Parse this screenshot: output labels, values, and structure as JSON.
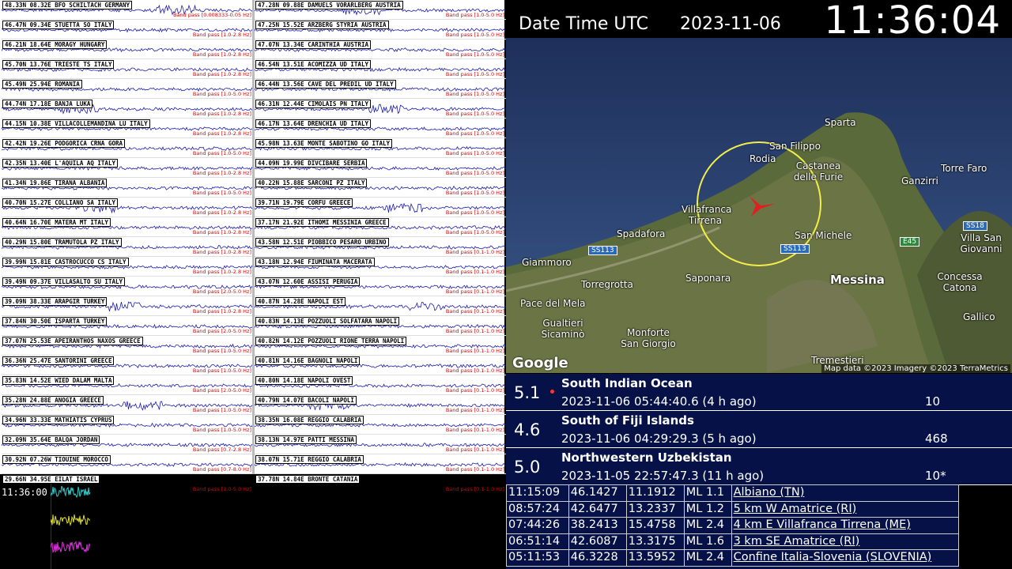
{
  "clock": {
    "label": "Date Time UTC",
    "date": "2023-11-06",
    "time": "11:36:04"
  },
  "stations_left": [
    {
      "name": "48.33N 08.32E BFO SCHILTACH GERMANY",
      "band": "Band pass [0.008333-0.05 Hz]"
    },
    {
      "name": "46.47N 09.34E STUETTA SO ITALY",
      "band": "Band pass [1.0-2.8 Hz]"
    },
    {
      "name": "46.21N 18.64E MORAGY HUNGARY",
      "band": "Band pass [1.0-2.8 Hz]"
    },
    {
      "name": "45.70N 13.76E TRIESTE TS ITALY",
      "band": "Band pass [1.0-2.8 Hz]"
    },
    {
      "name": "45.49N 25.94E ROMANIA",
      "band": "Band pass [1.0-5.0 Hz]"
    },
    {
      "name": "44.74N 17.18E BANJA LUKA",
      "band": "Band pass [1.0-2.8 Hz]"
    },
    {
      "name": "44.15N 10.38E VILLACOLLEMANDINA LU ITALY",
      "band": "Band pass [1.0-2.8 Hz]"
    },
    {
      "name": "42.42N 19.26E PODGORICA CRNA GORA",
      "band": "Band pass [1.0-5.0 Hz]"
    },
    {
      "name": "42.35N 13.40E L'AQUILA AQ ITALY",
      "band": "Band pass [1.0-2.8 Hz]"
    },
    {
      "name": "41.34N 19.86E TIRANA ALBANIA",
      "band": "Band pass [1.0-5.0 Hz]"
    },
    {
      "name": "40.70N 15.27E COLLIANO SA ITALY",
      "band": "Band pass [1.0-2.8 Hz]"
    },
    {
      "name": "40.64N 16.70E MATERA MT ITALY",
      "band": "Band pass [1.0-2.8 Hz]"
    },
    {
      "name": "40.29N 15.80E TRAMUTOLA PZ ITALY",
      "band": "Band pass [1.0-2.8 Hz]"
    },
    {
      "name": "39.99N 15.81E CASTROCUCCO CS ITALY",
      "band": "Band pass [1.0-2.8 Hz]"
    },
    {
      "name": "39.49N 09.37E VILLASALTO SU ITALY",
      "band": "Band pass [2.0-5.0 Hz]"
    },
    {
      "name": "39.09N 38.33E ARAPGIR TURKEY",
      "band": "Band pass [1.0-2.8 Hz]"
    },
    {
      "name": "37.84N 30.50E ISPARTA TURKEY",
      "band": "Band pass [2.0-5.0 Hz]"
    },
    {
      "name": "37.07N 25.53E APEIRANTHOS NAXOS GREECE",
      "band": "Band pass [1.0-5.0 Hz]"
    },
    {
      "name": "36.36N 25.47E SANTORINI GREECE",
      "band": "Band pass [1.0-5.0 Hz]"
    },
    {
      "name": "35.83N 14.52E WIED DALAM MALTA",
      "band": "Band pass [2.0-5.0 Hz]"
    },
    {
      "name": "35.28N 24.88E ANOGIA GREECE",
      "band": "Band pass [1.0-5.0 Hz]"
    },
    {
      "name": "34.96N 33.33E MATHIATIS CYPRUS",
      "band": "Band pass [1.0-5.0 Hz]"
    },
    {
      "name": "32.09N 35.64E BALQA JORDAN",
      "band": "Band pass [0.7-2.8 Hz]"
    },
    {
      "name": "30.92N 07.26W TIOUINE MOROCCO",
      "band": "Band pass [0.7-8.0 Hz]"
    },
    {
      "name": "29.66N 34.95E EILAT ISRAEL",
      "band": "Band pass [1.0-5.0 Hz]"
    }
  ],
  "stations_right": [
    {
      "name": "47.28N 09.88E DAMUELS VORARLBERG AUSTRIA",
      "band": "Band pass [1.0-5.0 Hz]"
    },
    {
      "name": "47.25N 15.52E ARZBERG STYRIA AUSTRIA",
      "band": "Band pass [1.0-5.0 Hz]"
    },
    {
      "name": "47.07N 13.34E CARINTHIA AUSTRIA",
      "band": "Band pass [1.0-5.0 Hz]"
    },
    {
      "name": "46.54N 13.51E ACOMIZZA UD ITALY",
      "band": "Band pass [1.0-5.0 Hz]"
    },
    {
      "name": "46.44N 13.56E CAVE DEL PREDIL UD ITALY",
      "band": "Band pass [1.0-5.0 Hz]"
    },
    {
      "name": "46.31N 12.44E CIMOLAIS PN ITALY",
      "band": "Band pass [1.0-5.0 Hz]"
    },
    {
      "name": "46.17N 13.64E DRENCHIA UD ITALY",
      "band": "Band pass [1.0-5.0 Hz]"
    },
    {
      "name": "45.98N 13.63E MONTE SABOTINO GO ITALY",
      "band": "Band pass [1.0-5.0 Hz]"
    },
    {
      "name": "44.09N 19.99E DIVCIBARE SERBIA",
      "band": "Band pass [1.0-5.0 Hz]"
    },
    {
      "name": "40.22N 15.88E SARCONI PZ ITALY",
      "band": "Band pass [1.0-5.0 Hz]"
    },
    {
      "name": "39.71N 19.79E CORFU GREECE",
      "band": "Band pass [1.0-5.0 Hz]"
    },
    {
      "name": "37.17N 21.92E ITHOMI MESSINIA GREECE",
      "band": "Band pass [1.0-5.0 Hz]"
    },
    {
      "name": "43.58N 12.51E PIOBBICO PESARO URBINO",
      "band": "Band pass [0.1-1.0 Hz]"
    },
    {
      "name": "43.18N 12.94E FIUMINATA MACERATA",
      "band": "Band pass [0.1-1.0 Hz]"
    },
    {
      "name": "43.07N 12.60E ASSISI PERUGIA",
      "band": "Band pass [0.1-1.0 Hz]"
    },
    {
      "name": "40.87N 14.28E NAPOLI EST",
      "band": "Band pass [0.1-1.0 Hz]"
    },
    {
      "name": "40.83N 14.13E POZZUOLI SOLFATARA NAPOLI",
      "band": "Band pass [0.1-1.0 Hz]"
    },
    {
      "name": "40.82N 14.12E POZZUOLI RIONE TERRA NAPOLI",
      "band": "Band pass [0.1-1.0 Hz]"
    },
    {
      "name": "40.81N 14.16E BAGNOLI NAPOLI",
      "band": "Band pass [0.1-1.0 Hz]"
    },
    {
      "name": "40.80N 14.18E NAPOLI OVEST",
      "band": "Band pass [0.1-1.0 Hz]"
    },
    {
      "name": "40.79N 14.07E BACOLI NAPOLI",
      "band": "Band pass [0.1-1.0 Hz]"
    },
    {
      "name": "38.35N 16.08E REGGIO CALABRIA",
      "band": "Band pass [0.1-1.0 Hz]"
    },
    {
      "name": "38.13N 14.97E PATTI MESSINA",
      "band": "Band pass [0.1-1.0 Hz]"
    },
    {
      "name": "38.07N 15.71E REGGIO CALABRIA",
      "band": "Band pass [0.1-1.0 Hz]"
    },
    {
      "name": "37.78N 14.84E BRONTE CATANIA",
      "band": "Band pass [0.1-1.0 Hz]"
    }
  ],
  "strip": {
    "time": "11:36:00"
  },
  "map": {
    "places": [
      "Sparta",
      "San Filippo",
      "Rodia",
      "Castanea delle Furie",
      "Torre Faro",
      "Ganzirri",
      "Villafranca Tirrena",
      "Spadafora",
      "San Michele",
      "Messina",
      "Giammoro",
      "Torregrotta",
      "Saponara",
      "Pace del Mela",
      "Gualtieri Sicaminò",
      "Monforte San Giorgio",
      "Villa San Giovanni",
      "Concessa Catona",
      "Gallico",
      "Tremestieri"
    ],
    "roads": [
      "SS113",
      "SS113",
      "E45",
      "SS18"
    ],
    "brand": "Google",
    "attribution": "Map data ©2023 Imagery ©2023 TerraMetrics"
  },
  "quakes": [
    {
      "mag": "5.1",
      "region": "South Indian Ocean",
      "datetime": "2023-11-06 05:44:40.6 (4 h ago)",
      "num": "10",
      "new": true
    },
    {
      "mag": "4.6",
      "region": "South of Fiji Islands",
      "datetime": "2023-11-06 04:29:29.3 (5 h ago)",
      "num": "468",
      "new": false
    },
    {
      "mag": "5.0",
      "region": "Northwestern Uzbekistan",
      "datetime": "2023-11-05 22:57:47.3 (11 h ago)",
      "num": "10*",
      "new": false
    }
  ],
  "local_quakes": [
    {
      "time": "11:15:09",
      "lat": "46.1427",
      "lon": "11.1912",
      "mag": "ML 1.1",
      "loc": "Albiano (TN)"
    },
    {
      "time": "08:57:24",
      "lat": "42.6477",
      "lon": "13.2337",
      "mag": "ML 1.2",
      "loc": "5 km W Amatrice (RI)"
    },
    {
      "time": "07:44:26",
      "lat": "38.2413",
      "lon": "15.4758",
      "mag": "ML 2.4",
      "loc": "4 km E Villafranca Tirrena (ME)"
    },
    {
      "time": "06:51:14",
      "lat": "42.6087",
      "lon": "13.3175",
      "mag": "ML 1.6",
      "loc": "3 km SE Amatrice (RI)"
    },
    {
      "time": "05:11:53",
      "lat": "46.3228",
      "lon": "13.5952",
      "mag": "ML 2.4",
      "loc": "Confine Italia-Slovenia (SLOVENIA)"
    }
  ]
}
